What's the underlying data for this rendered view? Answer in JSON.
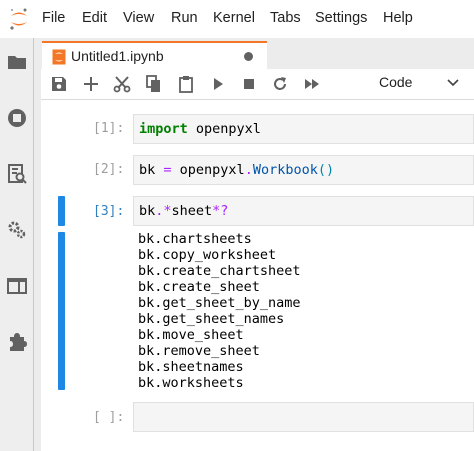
{
  "menubar": {
    "items": [
      "File",
      "Edit",
      "View",
      "Run",
      "Kernel",
      "Tabs",
      "Settings",
      "Help"
    ]
  },
  "sidebar": {
    "icons": [
      "folder-icon",
      "running-icon",
      "command-palette-icon",
      "property-inspector-icon",
      "tabs-icon",
      "extensions-icon"
    ]
  },
  "tab": {
    "title": "Untitled1.ipynb"
  },
  "toolbar": {
    "cell_type": "Code"
  },
  "cells": [
    {
      "prompt": "[1]:",
      "code": [
        [
          "kw",
          "import"
        ],
        [
          "txt",
          " openpyxl"
        ]
      ]
    },
    {
      "prompt": "[2]:",
      "code": [
        [
          "txt",
          "bk "
        ],
        [
          "op",
          "="
        ],
        [
          "txt",
          " openpyxl"
        ],
        [
          "op",
          "."
        ],
        [
          "fn",
          "Workbook"
        ],
        [
          "pn",
          "()"
        ]
      ]
    },
    {
      "prompt": "[3]:",
      "code": [
        [
          "txt",
          "bk"
        ],
        [
          "op",
          ".*"
        ],
        [
          "txt",
          "sheet"
        ],
        [
          "op",
          "*?"
        ]
      ]
    },
    {
      "prompt": "[ ]:",
      "code": []
    }
  ],
  "output": {
    "lines": [
      "bk.chartsheets",
      "bk.copy_worksheet",
      "bk.create_chartsheet",
      "bk.create_sheet",
      "bk.get_sheet_by_name",
      "bk.get_sheet_names",
      "bk.move_sheet",
      "bk.remove_sheet",
      "bk.sheetnames",
      "bk.worksheets"
    ]
  },
  "colors": {
    "accent": "#f37726",
    "active_cell": "#1e88e5"
  }
}
